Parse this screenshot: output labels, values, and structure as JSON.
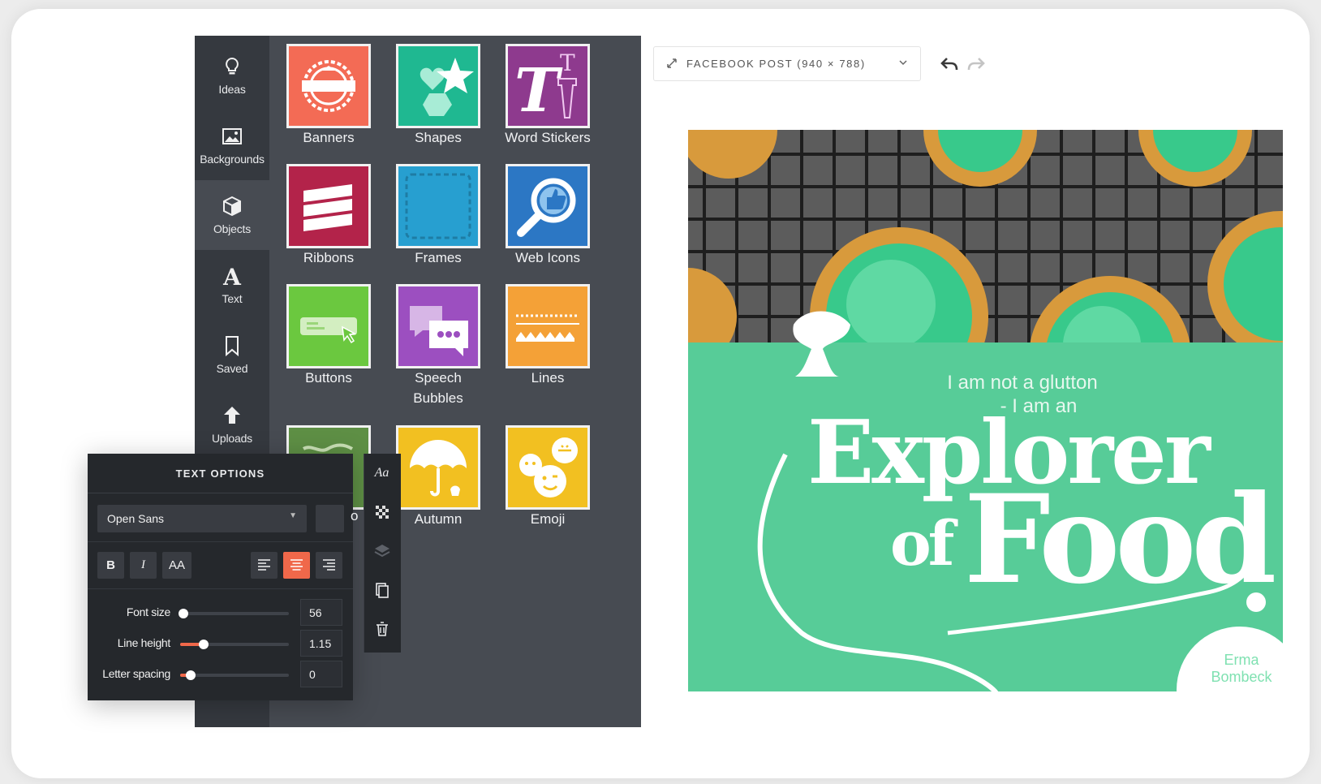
{
  "sidebar": {
    "items": [
      {
        "label": "Ideas",
        "icon": "lightbulb-icon"
      },
      {
        "label": "Backgrounds",
        "icon": "image-icon"
      },
      {
        "label": "Objects",
        "icon": "cube-icon"
      },
      {
        "label": "Text",
        "icon": "text-a-icon"
      },
      {
        "label": "Saved",
        "icon": "bookmark-icon"
      },
      {
        "label": "Uploads",
        "icon": "upload-arrow-icon"
      }
    ],
    "active": "Objects"
  },
  "objects": {
    "tiles": [
      {
        "label": "Banners",
        "color": "#f36b55"
      },
      {
        "label": "Shapes",
        "color": "#1fb891"
      },
      {
        "label": "Word Stickers",
        "color": "#8e3a8e"
      },
      {
        "label": "Ribbons",
        "color": "#b3234a"
      },
      {
        "label": "Frames",
        "color": "#279fd0"
      },
      {
        "label": "Web Icons",
        "color": "#2c77c4"
      },
      {
        "label": "Buttons",
        "color": "#6bc83f"
      },
      {
        "label": "Speech",
        "label2": "Bubbles",
        "color": "#9c4fc0"
      },
      {
        "label": "Lines",
        "color": "#f4a137"
      },
      {
        "label": "",
        "color": "#5e8f45"
      },
      {
        "label": "Autumn",
        "color": "#f2c021"
      },
      {
        "label": "Emoji",
        "color": "#f2c021"
      }
    ]
  },
  "text_options": {
    "title": "TEXT OPTIONS",
    "font": "Open Sans",
    "bold_label": "B",
    "italic_label": "I",
    "caps_label": "AA",
    "active_align": "center",
    "sliders": [
      {
        "label": "Font size",
        "value": "56",
        "fraction": 0.03
      },
      {
        "label": "Line height",
        "value": "1.15",
        "fraction": 0.22
      },
      {
        "label": "Letter spacing",
        "value": "0",
        "fraction": 0.1
      }
    ],
    "partial_label_fragment": "on"
  },
  "toolstrip": {
    "tools": [
      "font-style-icon",
      "transparency-icon",
      "layers-icon",
      "duplicate-icon",
      "trash-icon"
    ],
    "font_glyph": "Aa"
  },
  "topbar": {
    "format_label": "FACEBOOK POST (940 × 788)",
    "undo_icon": "undo-icon",
    "redo_icon": "redo-icon"
  },
  "canvas": {
    "accent_color": "#57cc98",
    "quote_line1": "I am not a glutton",
    "quote_line2": "- I am an",
    "headline_word1": "Explorer",
    "headline_word2": "of",
    "headline_word3": "Food",
    "author_line1": "Erma",
    "author_line2": "Bombeck"
  }
}
